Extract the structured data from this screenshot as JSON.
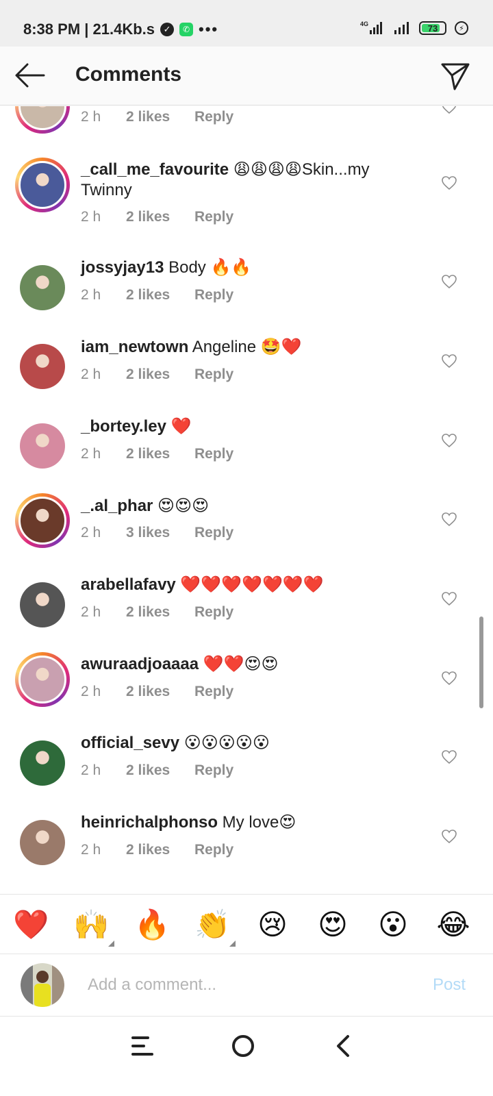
{
  "status_bar": {
    "time_speed": "8:38 PM | 21.4Kb.s",
    "more": "•••",
    "network": "4G",
    "battery": "73"
  },
  "header": {
    "title": "Comments"
  },
  "comments": [
    {
      "username": "",
      "text": "",
      "time": "2 h",
      "likes": "2 likes",
      "reply": "Reply",
      "ring": true,
      "avatar_color": "#c9b8a8"
    },
    {
      "username": "_call_me_favourite",
      "text": " 😩😩😩😩Skin...my Twinny",
      "time": "2 h",
      "likes": "2 likes",
      "reply": "Reply",
      "ring": true,
      "avatar_color": "#4a5a9a"
    },
    {
      "username": "jossyjay13",
      "text": " Body 🔥🔥",
      "time": "2 h",
      "likes": "2 likes",
      "reply": "Reply",
      "ring": false,
      "avatar_color": "#6a8a5a"
    },
    {
      "username": "iam_newtown",
      "text": " Angeline 🤩❤️",
      "time": "2 h",
      "likes": "2 likes",
      "reply": "Reply",
      "ring": false,
      "avatar_color": "#b84a4a"
    },
    {
      "username": "_bortey.ley",
      "text": " ❤️",
      "time": "2 h",
      "likes": "2 likes",
      "reply": "Reply",
      "ring": false,
      "avatar_color": "#d68aa0"
    },
    {
      "username": "_.al_phar",
      "text": " 😍😍😍",
      "time": "2 h",
      "likes": "3 likes",
      "reply": "Reply",
      "ring": true,
      "avatar_color": "#6a3a2a"
    },
    {
      "username": "arabellafavy",
      "text": " ❤️❤️❤️❤️❤️❤️❤️",
      "time": "2 h",
      "likes": "2 likes",
      "reply": "Reply",
      "ring": false,
      "avatar_color": "#555555"
    },
    {
      "username": "awuraadjoaaaa",
      "text": " ❤️❤️😍😍",
      "time": "2 h",
      "likes": "2 likes",
      "reply": "Reply",
      "ring": true,
      "avatar_color": "#c9a0b0"
    },
    {
      "username": "official_sevy",
      "text": " 😮😮😮😮😮",
      "time": "2 h",
      "likes": "2 likes",
      "reply": "Reply",
      "ring": false,
      "avatar_color": "#2e6a3a"
    },
    {
      "username": "heinrichalphonso",
      "text": " My love😍",
      "time": "2 h",
      "likes": "2 likes",
      "reply": "Reply",
      "ring": false,
      "avatar_color": "#9a7a6a"
    }
  ],
  "emoji_bar": [
    {
      "emoji": "❤️",
      "icon": "red-heart-icon",
      "has_variants": false
    },
    {
      "emoji": "🙌",
      "icon": "raising-hands-icon",
      "has_variants": true
    },
    {
      "emoji": "🔥",
      "icon": "fire-icon",
      "has_variants": false
    },
    {
      "emoji": "👏",
      "icon": "clapping-hands-icon",
      "has_variants": true
    },
    {
      "emoji": "😢",
      "icon": "crying-face-icon",
      "has_variants": false
    },
    {
      "emoji": "😍",
      "icon": "heart-eyes-icon",
      "has_variants": false
    },
    {
      "emoji": "😮",
      "icon": "surprised-face-icon",
      "has_variants": false
    },
    {
      "emoji": "😂",
      "icon": "tears-of-joy-icon",
      "has_variants": false
    }
  ],
  "composer": {
    "placeholder": "Add a comment...",
    "post_label": "Post"
  },
  "colors": {
    "post_disabled": "#b3dbf7",
    "meta_gray": "#8e8e8e"
  }
}
